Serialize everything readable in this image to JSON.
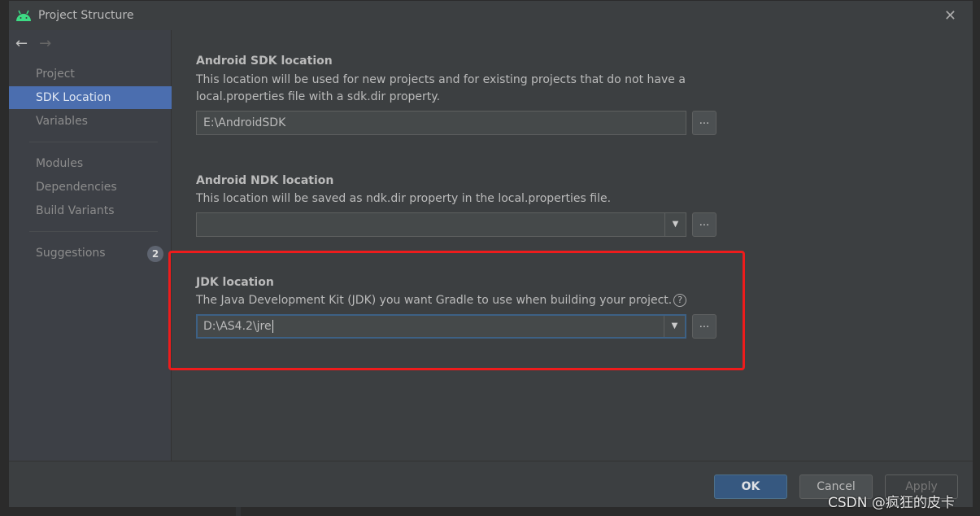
{
  "window": {
    "title": "Project Structure",
    "close_icon": "close-icon"
  },
  "sidebar": {
    "items": [
      {
        "label": "Project"
      },
      {
        "label": "SDK Location",
        "selected": true
      },
      {
        "label": "Variables"
      },
      {
        "label": "Modules"
      },
      {
        "label": "Dependencies"
      },
      {
        "label": "Build Variants"
      },
      {
        "label": "Suggestions",
        "badge": "2"
      }
    ]
  },
  "sdk": {
    "title": "Android SDK location",
    "desc": "This location will be used for new projects and for existing projects that do not have a local.properties file with a sdk.dir property.",
    "value": "E:\\AndroidSDK",
    "browse": "..."
  },
  "ndk": {
    "title": "Android NDK location",
    "desc": "This location will be saved as ndk.dir property in the local.properties file.",
    "value": "",
    "browse": "..."
  },
  "jdk": {
    "title": "JDK location",
    "desc": "The Java Development Kit (JDK) you want Gradle to use when building your project.",
    "help": "?",
    "value": "D:\\AS4.2\\jre",
    "browse": "..."
  },
  "footer": {
    "ok": "OK",
    "cancel": "Cancel",
    "apply": "Apply"
  },
  "watermark": "CSDN @疯狂的皮卡",
  "colors": {
    "accent": "#4b6eaf",
    "highlight": "#ee1c1c",
    "ok_button": "#365880"
  }
}
